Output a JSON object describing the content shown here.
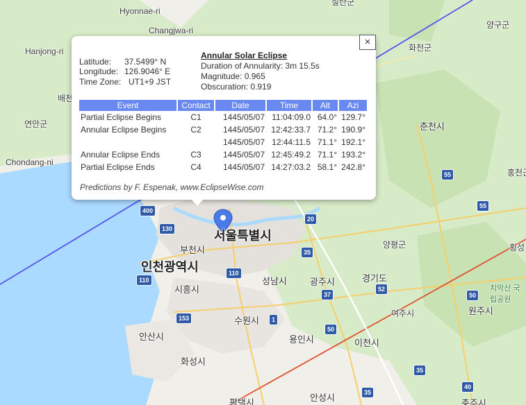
{
  "map": {
    "place_labels": [
      {
        "text": "실란군"
      },
      {
        "text": "Hyonnae-ri"
      },
      {
        "text": "Changjwa-ri"
      },
      {
        "text": "양구군"
      },
      {
        "text": "Hanjong-ri"
      },
      {
        "text": "화천군"
      },
      {
        "text": "배천"
      },
      {
        "text": "연안군"
      },
      {
        "text": "춘천시"
      },
      {
        "text": "Chondang-ni"
      },
      {
        "text": "홍천군"
      },
      {
        "text": "서울특별시"
      },
      {
        "text": "부천시"
      },
      {
        "text": "인천광역시"
      },
      {
        "text": "양평군"
      },
      {
        "text": "횡성"
      },
      {
        "text": "경기도"
      },
      {
        "text": "시흥시"
      },
      {
        "text": "성남시"
      },
      {
        "text": "광주시"
      },
      {
        "text": "치악산 국립공원"
      },
      {
        "text": "원주시"
      },
      {
        "text": "여주시"
      },
      {
        "text": "수원시"
      },
      {
        "text": "용인시"
      },
      {
        "text": "이천시"
      },
      {
        "text": "안산시"
      },
      {
        "text": "화성시"
      },
      {
        "text": "평택시"
      },
      {
        "text": "안성시"
      },
      {
        "text": "충주시"
      }
    ],
    "road_shields": [
      {
        "text": "400",
        "color": "blue"
      },
      {
        "text": "130",
        "color": "blue"
      },
      {
        "text": "110",
        "color": "blue"
      },
      {
        "text": "110",
        "color": "blue"
      },
      {
        "text": "153",
        "color": "blue"
      },
      {
        "text": "1",
        "color": "blue"
      },
      {
        "text": "35",
        "color": "blue"
      },
      {
        "text": "37",
        "color": "blue"
      },
      {
        "text": "50",
        "color": "blue"
      },
      {
        "text": "52",
        "color": "blue"
      },
      {
        "text": "35",
        "color": "blue"
      },
      {
        "text": "55",
        "color": "blue"
      },
      {
        "text": "55",
        "color": "blue"
      },
      {
        "text": "50",
        "color": "blue"
      },
      {
        "text": "35",
        "color": "blue"
      },
      {
        "text": "40",
        "color": "blue"
      },
      {
        "text": "20",
        "color": "blue"
      }
    ],
    "colors": {
      "water": "#aadaff",
      "land": "#f1efe9",
      "urban": "#e6e3df",
      "green": "#cfe6c1",
      "northern_limit_line": "#5555ee",
      "southern_limit_line": "#e05030",
      "central_line": "#ffffff"
    }
  },
  "popup": {
    "latitude_label": "Latitude:",
    "latitude_value": "37.5499° N",
    "longitude_label": "Longitude:",
    "longitude_value": "126.9046° E",
    "timezone_label": "Time Zone:",
    "timezone_value": "UT1+9 JST",
    "eclipse_title": "Annular Solar Eclipse",
    "duration": "Duration of Annularity: 3m 15.5s",
    "magnitude": "Magnitude:   0.965",
    "obscuration": "Obscuration: 0.919",
    "close_label": "×",
    "table": {
      "headers": [
        "Event",
        "Contact",
        "Date",
        "Time",
        "Alt",
        "Azi"
      ],
      "rows": [
        [
          "Partial Eclipse Begins",
          "C1",
          "1445/05/07",
          "11:04:09.0",
          "64.0°",
          "129.7°"
        ],
        [
          "Annular Eclipse Begins",
          "C2",
          "1445/05/07",
          "12:42:33.7",
          "71.2°",
          "190.9°"
        ],
        [
          "",
          "",
          "1445/05/07",
          "12:44:11.5",
          "71.1°",
          "192.1°"
        ],
        [
          "Annular Eclipse Ends",
          "C3",
          "1445/05/07",
          "12:45:49.2",
          "71.1°",
          "193.2°"
        ],
        [
          "Partial Eclipse Ends",
          "C4",
          "1445/05/07",
          "14:27:03.2",
          "58.1°",
          "242.8°"
        ]
      ]
    },
    "credit": "Predictions by F. Espenak, www.EclipseWise.com"
  }
}
